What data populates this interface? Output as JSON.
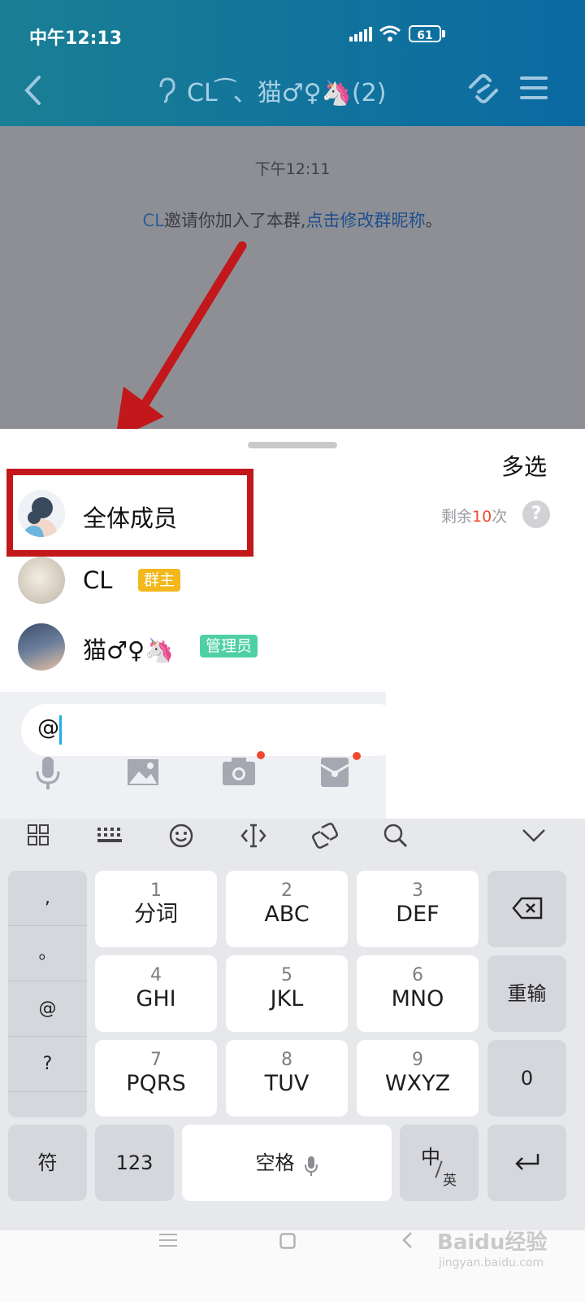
{
  "status_bar": {
    "time": "中午12:13",
    "battery": "61"
  },
  "header": {
    "title": "CL ͡ 、猫♂♀🦄(2)"
  },
  "chat": {
    "timestamp": "下午12:11",
    "system_sender": "CL",
    "system_text": "邀请你加入了本群,",
    "system_link": "点击修改群昵称",
    "system_end": "。"
  },
  "mention_sheet": {
    "multi_select": "多选",
    "everyone_label": "全体成员",
    "remaining_prefix": "剩余",
    "remaining_count": "10",
    "remaining_suffix": "次",
    "help_label": "?",
    "members": [
      {
        "name": "CL",
        "badge": "群主",
        "badge_color": "#f2b81c"
      },
      {
        "name": "猫♂♀🦄",
        "badge": "管理员",
        "badge_color": "#4fd0a3"
      }
    ]
  },
  "input": {
    "value": "@"
  },
  "keyboard": {
    "punct": [
      ",",
      "。",
      "@",
      "?"
    ],
    "rows": [
      [
        {
          "d": "1",
          "l": "分词"
        },
        {
          "d": "2",
          "l": "ABC"
        },
        {
          "d": "3",
          "l": "DEF"
        }
      ],
      [
        {
          "d": "4",
          "l": "GHI"
        },
        {
          "d": "5",
          "l": "JKL"
        },
        {
          "d": "6",
          "l": "MNO"
        }
      ],
      [
        {
          "d": "7",
          "l": "PQRS"
        },
        {
          "d": "8",
          "l": "TUV"
        },
        {
          "d": "9",
          "l": "WXYZ"
        }
      ]
    ],
    "retype": "重输",
    "zero": "0",
    "symbol": "符",
    "num": "123",
    "space": "空格",
    "lang_main": "中",
    "lang_sub": "英"
  },
  "watermark": {
    "brand": "Baidu经验",
    "url": "jingyan.baidu.com"
  },
  "colors": {
    "accent_red": "#c2171b",
    "link_blue": "#2c74c9",
    "count_red": "#f04a2f"
  }
}
